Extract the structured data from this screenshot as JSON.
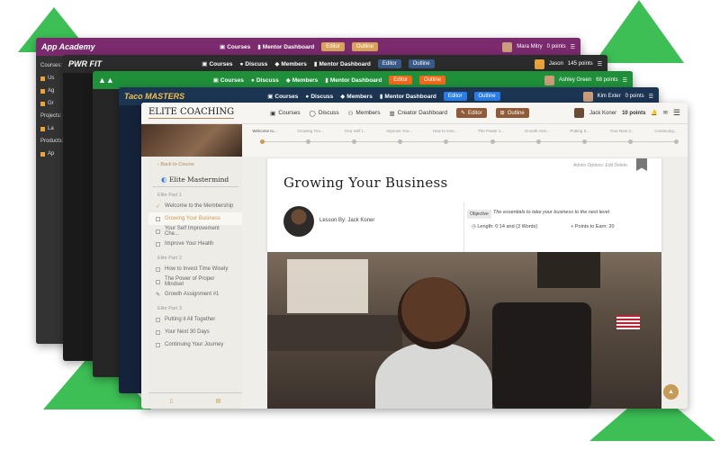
{
  "back_windows": [
    {
      "id": "app-academy",
      "logo": "App Academy",
      "color": "#7b2a6e",
      "nav": {
        "courses": "Courses",
        "dashboard": "Mentor Dashboard"
      },
      "editor": "Editor",
      "outline": "Outline",
      "user": "Mara Mitry",
      "points": "0 points",
      "sidebar": [
        "Courses:",
        "Us",
        "Ag",
        "Gr",
        "Projects:",
        "La",
        "Products:",
        "Ap"
      ]
    },
    {
      "id": "pwr-fit",
      "logo": "PWR FIT",
      "color": "#2b2b2b",
      "nav": {
        "courses": "Courses",
        "discuss": "Discuss",
        "members": "Members",
        "dashboard": "Mentor Dashboard"
      },
      "editor": "Editor",
      "outline": "Outline",
      "user": "Jason",
      "points": "145 points"
    },
    {
      "id": "green",
      "logo": "",
      "color": "#1f8f3a",
      "nav": {
        "courses": "Courses",
        "discuss": "Discuss",
        "members": "Members",
        "dashboard": "Mentor Dashboard"
      },
      "editor": "Editor",
      "outline": "Outline",
      "user": "Ashley Green",
      "points": "68 points"
    },
    {
      "id": "taco-masters",
      "logo": "Taco MASTERS",
      "color": "#1c3552",
      "nav": {
        "courses": "Courses",
        "discuss": "Discuss",
        "members": "Members",
        "dashboard": "Mentor Dashboard"
      },
      "editor": "Editor",
      "outline": "Outline",
      "user": "Kim Exter",
      "points": "0 points"
    }
  ],
  "front": {
    "brand": "ELITE COACHING",
    "nav": {
      "courses": "Courses",
      "discuss": "Discuss",
      "members": "Members",
      "dashboard": "Creator Dashboard"
    },
    "editor": "Editor",
    "outline": "Outline",
    "user": "Jack Koner",
    "points": "10 points",
    "progress_steps": [
      "Welcome to...",
      "Growing You...",
      "Your Self I...",
      "Improve You...",
      "How to Inve...",
      "The Power o...",
      "Growth Assi...",
      "Putting It...",
      "Your Next 3...",
      "Continuing..."
    ],
    "sidebar": {
      "back": "Back to Course",
      "title": "Elite Mastermind",
      "parts": [
        {
          "label": "Elite Part 1",
          "items": [
            "Welcome to the Membership",
            "Growing Your Business",
            "Your Self Improvement Che...",
            "Improve Your Health"
          ]
        },
        {
          "label": "Elite Part 2",
          "items": [
            "How to Invest Time Wisely",
            "The Power of Proper Mindset",
            "Growth Assignment #1"
          ]
        },
        {
          "label": "Elite Part 3",
          "items": [
            "Putting it All Together",
            "Your Next 30 Days",
            "Continuing Your Journey"
          ]
        }
      ]
    },
    "lesson": {
      "title": "Growing Your Business",
      "admin": "Admin Options:  Edit   Delete",
      "lesson_by": "Lesson By: Jack Koner",
      "objective_tag": "Objective",
      "objective": "The essentials to take your business to the next level",
      "length": "Length: 0:14 and (3 Words)",
      "points": "Points to Earn: 20"
    }
  },
  "colors": {
    "accent": "#c79a55",
    "brand_brown": "#8f5a37",
    "triangle_green": "#3dbf55",
    "blue_pill": "#2b7de9",
    "orange_pill": "#f06a1b"
  }
}
